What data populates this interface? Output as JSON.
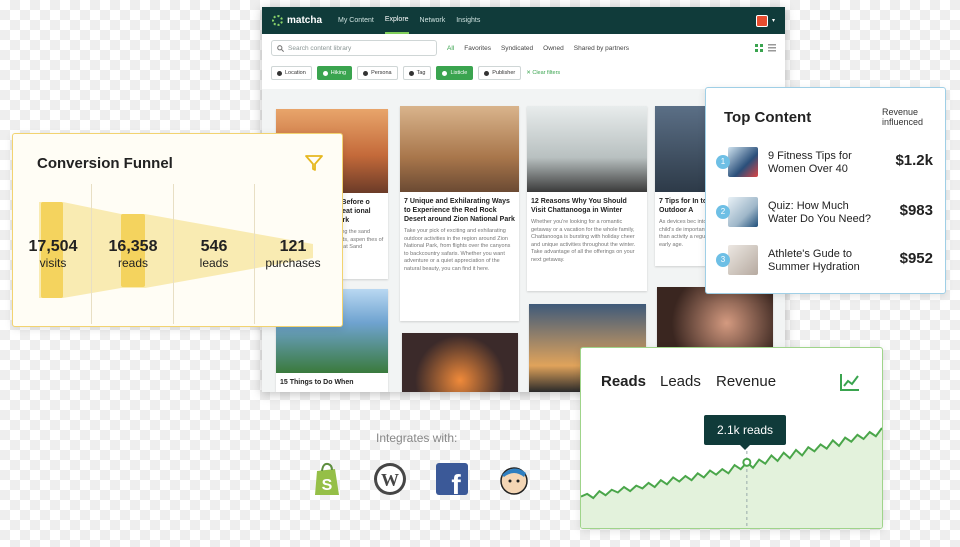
{
  "app": {
    "brand": "matcha",
    "nav": [
      "My Content",
      "Explore",
      "Network",
      "Insights"
    ],
    "search_placeholder": "Search content library",
    "source_tabs": [
      "All",
      "Favorites",
      "Syndicated",
      "Owned",
      "Shared by partners"
    ],
    "filters": [
      "Location",
      "Hiking",
      "Persona",
      "Tag",
      "Listicle",
      "Publisher"
    ],
    "clear_filters": "Clear filters",
    "cards": [
      {
        "title": "w Before o Great ional Park",
        "desc": "loring the sand lands, aspen thes of Great Sand"
      },
      {
        "title": "7 Unique and Exhilarating Ways to Experience the Red Rock Desert around Zion National Park",
        "desc": "Take your pick of exciting and exhilarating outdoor activities in the region around Zion National Park, from flights over the canyons to backcountry safaris. Whether you want adventure or a quiet appreciation of the natural beauty, you can find it here."
      },
      {
        "title": "12 Reasons Why You Should Visit Chattanooga in Winter",
        "desc": "Whether you're looking for a romantic getaway or a vacation for the whole family, Chattanooga is bursting with holiday cheer and unique activities throughout the winter. Take advantage of all the offerings on your next getaway."
      },
      {
        "title": "7 Tips for In to Outdoor A",
        "desc": "As devices bec into a child's de important than activity a regula early age."
      },
      {
        "title": "15 Things to Do When",
        "desc": ""
      }
    ]
  },
  "funnel": {
    "title": "Conversion Funnel",
    "stats": [
      {
        "value": "17,504",
        "label": "visits"
      },
      {
        "value": "16,358",
        "label": "reads"
      },
      {
        "value": "546",
        "label": "leads"
      },
      {
        "value": "121",
        "label": "purchases"
      }
    ],
    "accent": "#f2d370"
  },
  "top_content": {
    "title": "Top Content",
    "revenue_header": "Revenue influenced",
    "items": [
      {
        "rank": "1",
        "title": "9 Fitness Tips for Women Over 40",
        "value": "$1.2k"
      },
      {
        "rank": "2",
        "title": "Quiz: How Much Water Do You Need?",
        "value": "$983"
      },
      {
        "rank": "3",
        "title": "Athlete's Gude to Summer Hydration",
        "value": "$952"
      }
    ]
  },
  "reads_chart": {
    "tabs": [
      "Reads",
      "Leads",
      "Revenue"
    ],
    "tooltip": "2.1k reads",
    "series": [
      10,
      12,
      9,
      14,
      11,
      15,
      13,
      17,
      14,
      18,
      16,
      20,
      17,
      22,
      19,
      24,
      21,
      25,
      22,
      27,
      24,
      29,
      26,
      30,
      27,
      33,
      30,
      35,
      31,
      37,
      34,
      40,
      36,
      42,
      38,
      44,
      40,
      46,
      43,
      48,
      45,
      51,
      47,
      53,
      50,
      55,
      52,
      57,
      54,
      60
    ]
  },
  "integrations": {
    "label": "Integrates with:",
    "logos": [
      "shopify-icon",
      "wordpress-icon",
      "facebook-icon",
      "mailchimp-icon"
    ]
  }
}
